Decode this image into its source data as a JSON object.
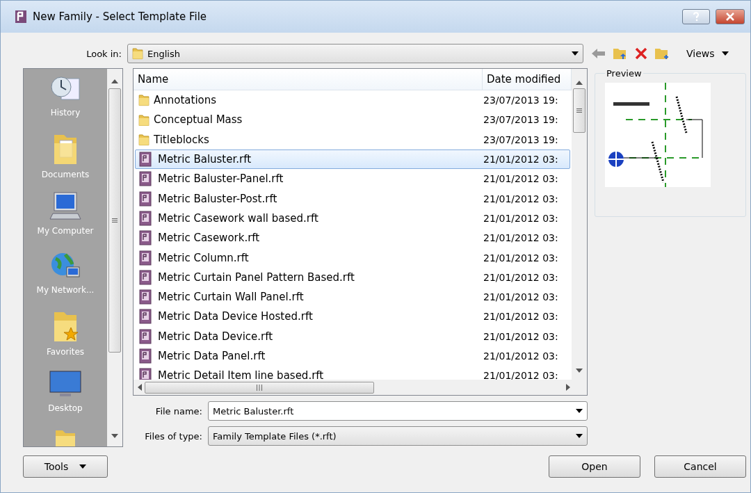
{
  "window": {
    "title": "New Family - Select Template File"
  },
  "look_in": {
    "label": "Look in:",
    "value": "English"
  },
  "toolbar": {
    "views": "Views"
  },
  "places": [
    {
      "label": "History",
      "kind": "history"
    },
    {
      "label": "Documents",
      "kind": "documents"
    },
    {
      "label": "My Computer",
      "kind": "computer"
    },
    {
      "label": "My Network...",
      "kind": "network"
    },
    {
      "label": "Favorites",
      "kind": "favorites"
    },
    {
      "label": "Desktop",
      "kind": "desktop"
    },
    {
      "kind": "folder"
    }
  ],
  "table": {
    "columns": [
      "Name",
      "Date modified"
    ],
    "rows": [
      {
        "name": "Annotations",
        "date": "23/07/2013 19:",
        "kind": "folder",
        "selected": false
      },
      {
        "name": "Conceptual Mass",
        "date": "23/07/2013 19:",
        "kind": "folder",
        "selected": false
      },
      {
        "name": "Titleblocks",
        "date": "23/07/2013 19:",
        "kind": "folder",
        "selected": false
      },
      {
        "name": "Metric Baluster.rft",
        "date": "21/01/2012 03:",
        "kind": "file",
        "selected": true
      },
      {
        "name": "Metric Baluster-Panel.rft",
        "date": "21/01/2012 03:",
        "kind": "file",
        "selected": false
      },
      {
        "name": "Metric Baluster-Post.rft",
        "date": "21/01/2012 03:",
        "kind": "file",
        "selected": false
      },
      {
        "name": "Metric Casework wall based.rft",
        "date": "21/01/2012 03:",
        "kind": "file",
        "selected": false
      },
      {
        "name": "Metric Casework.rft",
        "date": "21/01/2012 03:",
        "kind": "file",
        "selected": false
      },
      {
        "name": "Metric Column.rft",
        "date": "21/01/2012 03:",
        "kind": "file",
        "selected": false
      },
      {
        "name": "Metric Curtain Panel Pattern Based.rft",
        "date": "21/01/2012 03:",
        "kind": "file",
        "selected": false
      },
      {
        "name": "Metric Curtain Wall Panel.rft",
        "date": "21/01/2012 03:",
        "kind": "file",
        "selected": false
      },
      {
        "name": "Metric Data Device Hosted.rft",
        "date": "21/01/2012 03:",
        "kind": "file",
        "selected": false
      },
      {
        "name": "Metric Data Device.rft",
        "date": "21/01/2012 03:",
        "kind": "file",
        "selected": false
      },
      {
        "name": "Metric Data Panel.rft",
        "date": "21/01/2012 03:",
        "kind": "file",
        "selected": false
      },
      {
        "name": "Metric Detail Item line based.rft",
        "date": "21/01/2012 03:",
        "kind": "file",
        "selected": false
      }
    ]
  },
  "preview": {
    "label": "Preview"
  },
  "file_name": {
    "label": "File name:",
    "value": "Metric Baluster.rft"
  },
  "file_type": {
    "label": "Files of type:",
    "value": "Family Template Files  (*.rft)"
  },
  "buttons": {
    "tools": "Tools",
    "open": "Open",
    "cancel": "Cancel"
  }
}
